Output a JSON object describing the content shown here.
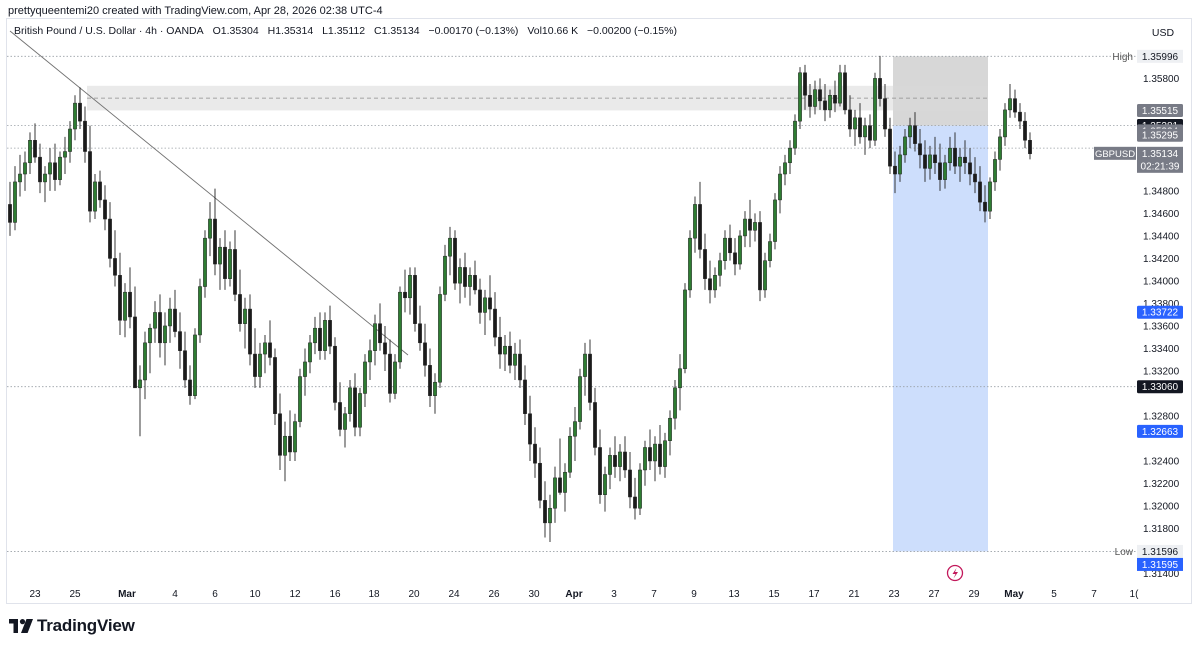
{
  "credit": "prettyqueentemi20 created with TradingView.com, Apr 28, 2026 02:38 UTC-4",
  "legend": {
    "symbol": "British Pound / U.S. Dollar · 4h · OANDA",
    "open": "O1.35304",
    "high": "H1.35314",
    "low": "L1.35112",
    "close": "C1.35134",
    "change": "−0.00170 (−0.13%)",
    "volume": "Vol10.66 K",
    "spread": "−0.00200 (−0.15%)"
  },
  "currency": "USD",
  "brand": "TradingView",
  "colors": {
    "up": "#2e7d32",
    "down": "#1b1b1b",
    "target_zone": "#bcd3fb",
    "stop_zone": "#c9c9c9",
    "price_tag": "#131722",
    "blue_tag": "#2962ff",
    "grey_tag": "#787b86"
  },
  "chart_data": {
    "type": "candlestick",
    "ylim": [
      1.3128,
      1.3607
    ],
    "y_ticks": [
      "1.35800",
      "1.34800",
      "1.34600",
      "1.34400",
      "1.34200",
      "1.34000",
      "1.33800",
      "1.33600",
      "1.33400",
      "1.33200",
      "1.32800",
      "1.32400",
      "1.32200",
      "1.32000",
      "1.31800",
      "1.31400"
    ],
    "x_ticks": [
      "23",
      "25",
      "Mar",
      "4",
      "6",
      "10",
      "12",
      "16",
      "18",
      "20",
      "24",
      "26",
      "30",
      "Apr",
      "3",
      "7",
      "9",
      "13",
      "15",
      "17",
      "21",
      "23",
      "27",
      "29",
      "May",
      "5",
      "7",
      "1("
    ],
    "x_tick_bold": [
      "Mar",
      "Apr",
      "May"
    ],
    "high_label": "High",
    "high_value": "1.35996",
    "low_label": "Low",
    "low_value": "1.31596",
    "low_value_2": "1.31595",
    "symbol_tag": "GBPUSD",
    "last_price": "1.35134",
    "countdown": "02:21:39",
    "price_tags": [
      {
        "value": "1.35515",
        "style": "grey"
      },
      {
        "value": "1.35381",
        "style": "dark"
      },
      {
        "value": "1.35334",
        "style": "grey"
      },
      {
        "value": "1.35295",
        "style": "grey"
      },
      {
        "value": "1.33722",
        "style": "blue"
      },
      {
        "value": "1.33060",
        "style": "dark"
      },
      {
        "value": "1.32663",
        "style": "blue"
      }
    ],
    "zone_levels": {
      "zone_top": 1.35996,
      "entry": 1.3538,
      "target": 1.31596,
      "resistance_top": 1.35734,
      "resistance_bottom": 1.35515
    },
    "trendline": {
      "from": [
        "Feb 20",
        1.36
      ],
      "to": [
        "Mar 20",
        1.332
      ]
    },
    "horizontal_levels": [
      1.35996,
      1.3538,
      1.3518,
      1.3306,
      1.31596
    ],
    "candles": [
      [
        1.3468,
        1.3488,
        1.344,
        1.3452
      ],
      [
        1.3452,
        1.3502,
        1.3445,
        1.3488
      ],
      [
        1.3488,
        1.3512,
        1.3475,
        1.3495
      ],
      [
        1.3495,
        1.3515,
        1.348,
        1.3505
      ],
      [
        1.3505,
        1.3532,
        1.3495,
        1.3525
      ],
      [
        1.3525,
        1.354,
        1.3505,
        1.351
      ],
      [
        1.351,
        1.3522,
        1.3478,
        1.3488
      ],
      [
        1.3488,
        1.3502,
        1.347,
        1.3495
      ],
      [
        1.3495,
        1.3518,
        1.348,
        1.3505
      ],
      [
        1.3505,
        1.3522,
        1.348,
        1.349
      ],
      [
        1.349,
        1.3515,
        1.3485,
        1.351
      ],
      [
        1.351,
        1.3528,
        1.3495,
        1.3515
      ],
      [
        1.3515,
        1.3542,
        1.3505,
        1.3535
      ],
      [
        1.3535,
        1.3565,
        1.3525,
        1.3558
      ],
      [
        1.3558,
        1.3572,
        1.3535,
        1.3542
      ],
      [
        1.3542,
        1.3555,
        1.3505,
        1.3515
      ],
      [
        1.3515,
        1.3538,
        1.3452,
        1.3462
      ],
      [
        1.3462,
        1.3495,
        1.3455,
        1.3488
      ],
      [
        1.3488,
        1.3498,
        1.3465,
        1.3472
      ],
      [
        1.3472,
        1.3485,
        1.3445,
        1.3455
      ],
      [
        1.3455,
        1.347,
        1.3412,
        1.342
      ],
      [
        1.342,
        1.3445,
        1.3395,
        1.3405
      ],
      [
        1.3405,
        1.3425,
        1.3352,
        1.3365
      ],
      [
        1.3365,
        1.3398,
        1.335,
        1.339
      ],
      [
        1.339,
        1.3412,
        1.3358,
        1.3368
      ],
      [
        1.3368,
        1.3395,
        1.3322,
        1.3305
      ],
      [
        1.3305,
        1.3325,
        1.3262,
        1.3312
      ],
      [
        1.3312,
        1.3355,
        1.3295,
        1.3345
      ],
      [
        1.3345,
        1.3362,
        1.3318,
        1.3358
      ],
      [
        1.3358,
        1.3382,
        1.3345,
        1.3372
      ],
      [
        1.3372,
        1.3388,
        1.3332,
        1.3345
      ],
      [
        1.3345,
        1.3372,
        1.3325,
        1.336
      ],
      [
        1.336,
        1.3385,
        1.3345,
        1.3375
      ],
      [
        1.3375,
        1.3392,
        1.335,
        1.3355
      ],
      [
        1.3355,
        1.3372,
        1.3322,
        1.3338
      ],
      [
        1.3338,
        1.3355,
        1.3305,
        1.3312
      ],
      [
        1.3312,
        1.3325,
        1.329,
        1.3298
      ],
      [
        1.3298,
        1.3358,
        1.3295,
        1.3352
      ],
      [
        1.3352,
        1.3402,
        1.3345,
        1.3395
      ],
      [
        1.3395,
        1.3445,
        1.3385,
        1.3438
      ],
      [
        1.3438,
        1.347,
        1.3422,
        1.3455
      ],
      [
        1.3455,
        1.3482,
        1.3405,
        1.3415
      ],
      [
        1.3415,
        1.3438,
        1.3392,
        1.343
      ],
      [
        1.343,
        1.3445,
        1.3392,
        1.3402
      ],
      [
        1.3402,
        1.3435,
        1.3395,
        1.3428
      ],
      [
        1.3428,
        1.3445,
        1.3382,
        1.3388
      ],
      [
        1.3388,
        1.341,
        1.3355,
        1.3362
      ],
      [
        1.3362,
        1.3385,
        1.334,
        1.3375
      ],
      [
        1.3375,
        1.3388,
        1.3325,
        1.3335
      ],
      [
        1.3335,
        1.3358,
        1.3305,
        1.3315
      ],
      [
        1.3315,
        1.3345,
        1.3305,
        1.3335
      ],
      [
        1.3335,
        1.3352,
        1.3318,
        1.3345
      ],
      [
        1.3345,
        1.3365,
        1.3325,
        1.3332
      ],
      [
        1.3332,
        1.334,
        1.3272,
        1.3282
      ],
      [
        1.3282,
        1.33,
        1.3232,
        1.3245
      ],
      [
        1.3245,
        1.3275,
        1.3222,
        1.3262
      ],
      [
        1.3262,
        1.3285,
        1.324,
        1.3248
      ],
      [
        1.3248,
        1.3282,
        1.324,
        1.3275
      ],
      [
        1.3275,
        1.3322,
        1.327,
        1.3315
      ],
      [
        1.3315,
        1.334,
        1.3298,
        1.3328
      ],
      [
        1.3328,
        1.3352,
        1.3318,
        1.3345
      ],
      [
        1.3345,
        1.3368,
        1.3335,
        1.3358
      ],
      [
        1.3358,
        1.3372,
        1.333,
        1.3338
      ],
      [
        1.3338,
        1.3372,
        1.333,
        1.3365
      ],
      [
        1.3365,
        1.3378,
        1.3335,
        1.3342
      ],
      [
        1.3342,
        1.335,
        1.3285,
        1.3292
      ],
      [
        1.3292,
        1.331,
        1.3262,
        1.3268
      ],
      [
        1.3268,
        1.3288,
        1.3252,
        1.3282
      ],
      [
        1.3282,
        1.3312,
        1.3275,
        1.3305
      ],
      [
        1.3305,
        1.3318,
        1.3262,
        1.327
      ],
      [
        1.327,
        1.3305,
        1.3262,
        1.33
      ],
      [
        1.33,
        1.3335,
        1.3288,
        1.3328
      ],
      [
        1.3328,
        1.3348,
        1.3312,
        1.3338
      ],
      [
        1.3338,
        1.337,
        1.3325,
        1.3362
      ],
      [
        1.3362,
        1.338,
        1.3338,
        1.3345
      ],
      [
        1.3345,
        1.336,
        1.332,
        1.3335
      ],
      [
        1.3335,
        1.3348,
        1.3292,
        1.33
      ],
      [
        1.33,
        1.3335,
        1.3295,
        1.3328
      ],
      [
        1.3328,
        1.3395,
        1.3322,
        1.339
      ],
      [
        1.339,
        1.341,
        1.3372,
        1.3385
      ],
      [
        1.3385,
        1.3412,
        1.337,
        1.3405
      ],
      [
        1.3405,
        1.3412,
        1.3355,
        1.3362
      ],
      [
        1.3362,
        1.3378,
        1.3338,
        1.3345
      ],
      [
        1.3345,
        1.3362,
        1.3315,
        1.3325
      ],
      [
        1.3325,
        1.334,
        1.3288,
        1.3298
      ],
      [
        1.3298,
        1.3318,
        1.3282,
        1.331
      ],
      [
        1.331,
        1.3395,
        1.3305,
        1.3388
      ],
      [
        1.3388,
        1.3432,
        1.3382,
        1.3422
      ],
      [
        1.3422,
        1.3448,
        1.3405,
        1.3438
      ],
      [
        1.3438,
        1.3445,
        1.3392,
        1.3398
      ],
      [
        1.3398,
        1.342,
        1.338,
        1.3412
      ],
      [
        1.3412,
        1.3425,
        1.3385,
        1.3395
      ],
      [
        1.3395,
        1.3412,
        1.3378,
        1.3405
      ],
      [
        1.3405,
        1.3418,
        1.3388,
        1.3392
      ],
      [
        1.3392,
        1.3402,
        1.3362,
        1.3372
      ],
      [
        1.3372,
        1.3392,
        1.3352,
        1.3385
      ],
      [
        1.3385,
        1.3405,
        1.3365,
        1.3375
      ],
      [
        1.3375,
        1.339,
        1.3342,
        1.335
      ],
      [
        1.335,
        1.3368,
        1.3322,
        1.3335
      ],
      [
        1.3335,
        1.3352,
        1.332,
        1.3342
      ],
      [
        1.3342,
        1.3355,
        1.3318,
        1.3325
      ],
      [
        1.3325,
        1.3345,
        1.3312,
        1.3335
      ],
      [
        1.3335,
        1.3348,
        1.3305,
        1.3312
      ],
      [
        1.3312,
        1.3325,
        1.3272,
        1.3282
      ],
      [
        1.3282,
        1.3298,
        1.324,
        1.3255
      ],
      [
        1.3255,
        1.327,
        1.3225,
        1.3238
      ],
      [
        1.3238,
        1.3252,
        1.3198,
        1.3205
      ],
      [
        1.3205,
        1.3222,
        1.3172,
        1.3185
      ],
      [
        1.3185,
        1.321,
        1.3168,
        1.3198
      ],
      [
        1.3198,
        1.3235,
        1.3185,
        1.3225
      ],
      [
        1.3225,
        1.326,
        1.321,
        1.3212
      ],
      [
        1.3212,
        1.3238,
        1.3195,
        1.323
      ],
      [
        1.323,
        1.327,
        1.3225,
        1.3262
      ],
      [
        1.3262,
        1.3288,
        1.324,
        1.3275
      ],
      [
        1.3275,
        1.3322,
        1.3268,
        1.3315
      ],
      [
        1.3315,
        1.3345,
        1.3298,
        1.3335
      ],
      [
        1.3335,
        1.3348,
        1.3285,
        1.3292
      ],
      [
        1.3292,
        1.3305,
        1.3245,
        1.3252
      ],
      [
        1.3252,
        1.3268,
        1.3202,
        1.321
      ],
      [
        1.321,
        1.3235,
        1.3195,
        1.3228
      ],
      [
        1.3228,
        1.3252,
        1.3215,
        1.3245
      ],
      [
        1.3245,
        1.3262,
        1.3225,
        1.3235
      ],
      [
        1.3235,
        1.3255,
        1.3222,
        1.3248
      ],
      [
        1.3248,
        1.3262,
        1.3225,
        1.3232
      ],
      [
        1.3232,
        1.3248,
        1.3198,
        1.3208
      ],
      [
        1.3208,
        1.3225,
        1.3188,
        1.3198
      ],
      [
        1.3198,
        1.3238,
        1.3192,
        1.3232
      ],
      [
        1.3232,
        1.3258,
        1.3218,
        1.3252
      ],
      [
        1.3252,
        1.3268,
        1.3232,
        1.324
      ],
      [
        1.324,
        1.3262,
        1.3222,
        1.3255
      ],
      [
        1.3255,
        1.3272,
        1.3228,
        1.3235
      ],
      [
        1.3235,
        1.3265,
        1.3225,
        1.3258
      ],
      [
        1.3258,
        1.3285,
        1.3245,
        1.3278
      ],
      [
        1.3278,
        1.3312,
        1.3268,
        1.3305
      ],
      [
        1.3305,
        1.3335,
        1.3285,
        1.3322
      ],
      [
        1.3322,
        1.3398,
        1.3318,
        1.3392
      ],
      [
        1.3392,
        1.3445,
        1.3385,
        1.3438
      ],
      [
        1.3438,
        1.3475,
        1.3425,
        1.3468
      ],
      [
        1.3468,
        1.3488,
        1.342,
        1.3428
      ],
      [
        1.3428,
        1.3442,
        1.3392,
        1.3402
      ],
      [
        1.3402,
        1.3418,
        1.338,
        1.3392
      ],
      [
        1.3392,
        1.3412,
        1.3385,
        1.3405
      ],
      [
        1.3405,
        1.3425,
        1.3395,
        1.3418
      ],
      [
        1.3418,
        1.3445,
        1.341,
        1.3438
      ],
      [
        1.3438,
        1.345,
        1.3418,
        1.3425
      ],
      [
        1.3425,
        1.3438,
        1.3405,
        1.3415
      ],
      [
        1.3415,
        1.3445,
        1.341,
        1.344
      ],
      [
        1.344,
        1.3462,
        1.343,
        1.3455
      ],
      [
        1.3455,
        1.3472,
        1.343,
        1.3445
      ],
      [
        1.3445,
        1.346,
        1.3435,
        1.3452
      ],
      [
        1.3452,
        1.3462,
        1.3382,
        1.3392
      ],
      [
        1.3392,
        1.3425,
        1.3385,
        1.3418
      ],
      [
        1.3418,
        1.3442,
        1.3412,
        1.3435
      ],
      [
        1.3435,
        1.3478,
        1.3428,
        1.3472
      ],
      [
        1.3472,
        1.3502,
        1.346,
        1.3495
      ],
      [
        1.3495,
        1.3512,
        1.3485,
        1.3505
      ],
      [
        1.3505,
        1.3525,
        1.3495,
        1.3518
      ],
      [
        1.3518,
        1.3548,
        1.3512,
        1.3542
      ],
      [
        1.3542,
        1.359,
        1.3535,
        1.3585
      ],
      [
        1.3585,
        1.3592,
        1.3552,
        1.3565
      ],
      [
        1.3565,
        1.3575,
        1.3545,
        1.3555
      ],
      [
        1.3555,
        1.3578,
        1.3548,
        1.357
      ],
      [
        1.357,
        1.358,
        1.3552,
        1.356
      ],
      [
        1.356,
        1.3575,
        1.3542,
        1.3552
      ],
      [
        1.3552,
        1.357,
        1.3545,
        1.3565
      ],
      [
        1.3565,
        1.3578,
        1.355,
        1.3558
      ],
      [
        1.3558,
        1.3592,
        1.3555,
        1.3585
      ],
      [
        1.3585,
        1.3592,
        1.3548,
        1.3552
      ],
      [
        1.3552,
        1.3565,
        1.3528,
        1.3535
      ],
      [
        1.3535,
        1.3552,
        1.352,
        1.3545
      ],
      [
        1.3545,
        1.3558,
        1.3522,
        1.3528
      ],
      [
        1.3528,
        1.3545,
        1.3512,
        1.3538
      ],
      [
        1.3538,
        1.3548,
        1.3518,
        1.3525
      ],
      [
        1.3525,
        1.3585,
        1.352,
        1.358
      ],
      [
        1.358,
        1.36,
        1.3555,
        1.3562
      ],
      [
        1.3562,
        1.3575,
        1.3528,
        1.3535
      ],
      [
        1.3535,
        1.3545,
        1.3495,
        1.3502
      ],
      [
        1.3502,
        1.3515,
        1.3478,
        1.3495
      ],
      [
        1.3495,
        1.352,
        1.3488,
        1.3512
      ],
      [
        1.3512,
        1.3535,
        1.3505,
        1.3528
      ],
      [
        1.3528,
        1.3545,
        1.3518,
        1.3538
      ],
      [
        1.3538,
        1.355,
        1.3515,
        1.3522
      ],
      [
        1.3522,
        1.3535,
        1.35,
        1.3512
      ],
      [
        1.3512,
        1.3525,
        1.3488,
        1.35
      ],
      [
        1.35,
        1.352,
        1.349,
        1.3512
      ],
      [
        1.3512,
        1.3528,
        1.3495,
        1.3505
      ],
      [
        1.3505,
        1.3522,
        1.348,
        1.349
      ],
      [
        1.349,
        1.3512,
        1.3482,
        1.3505
      ],
      [
        1.3505,
        1.3528,
        1.3498,
        1.3518
      ],
      [
        1.3518,
        1.3532,
        1.3495,
        1.3502
      ],
      [
        1.3502,
        1.3518,
        1.3488,
        1.351
      ],
      [
        1.351,
        1.3525,
        1.3495,
        1.3505
      ],
      [
        1.3505,
        1.3518,
        1.3485,
        1.3495
      ],
      [
        1.3495,
        1.351,
        1.3478,
        1.3488
      ],
      [
        1.3488,
        1.3502,
        1.3462,
        1.347
      ],
      [
        1.347,
        1.3485,
        1.3452,
        1.3462
      ],
      [
        1.3462,
        1.3492,
        1.3455,
        1.3488
      ],
      [
        1.3488,
        1.3515,
        1.348,
        1.3508
      ],
      [
        1.3508,
        1.3535,
        1.3498,
        1.3528
      ],
      [
        1.3528,
        1.3558,
        1.352,
        1.3552
      ],
      [
        1.3552,
        1.3575,
        1.3545,
        1.3562
      ],
      [
        1.3562,
        1.357,
        1.3545,
        1.355
      ],
      [
        1.355,
        1.3558,
        1.3535,
        1.3542
      ],
      [
        1.3542,
        1.355,
        1.3518,
        1.3525
      ],
      [
        1.3525,
        1.3532,
        1.3508,
        1.3513
      ]
    ]
  }
}
